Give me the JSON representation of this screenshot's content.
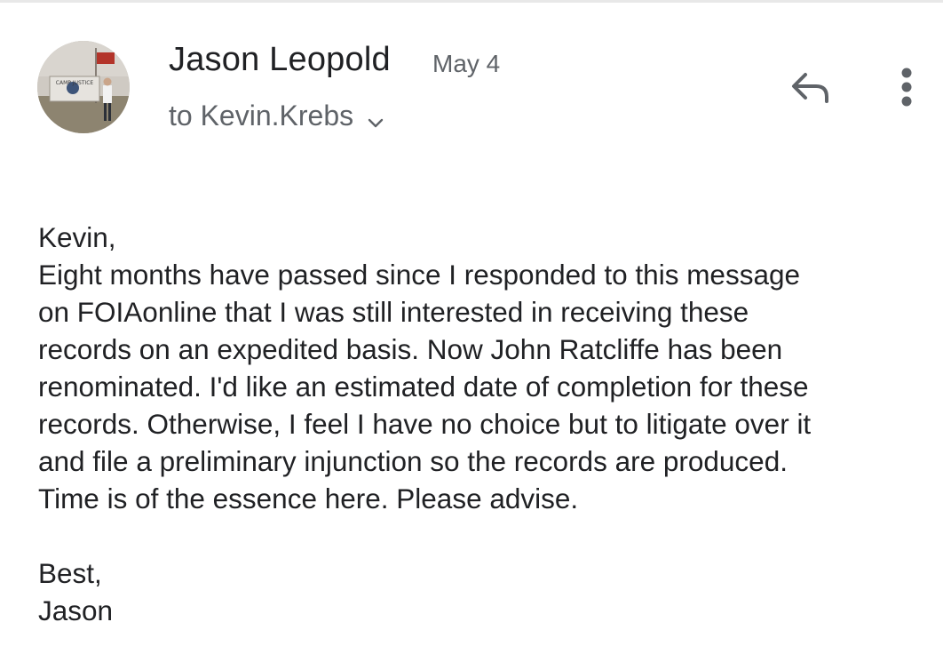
{
  "message": {
    "sender_name": "Jason Leopold",
    "date": "May 4",
    "recipient_label": "to Kevin.Krebs",
    "body_lines": [
      "Kevin,",
      "Eight months have passed since I responded to this message",
      "on FOIAonline that I was still interested in receiving these",
      "records on an expedited basis. Now John Ratcliffe has been",
      "renominated. I'd like an estimated date of completion for these",
      "records. Otherwise, I feel I have no choice but to litigate over it",
      "and file a preliminary injunction so the records are produced.",
      "Time is of the essence here. Please advise."
    ],
    "signoff_lines": [
      "Best,",
      "Jason"
    ]
  },
  "avatar_sign_text": "CAMP JUSTICE",
  "icons": {
    "reply": "reply-icon",
    "more": "more-vert-icon",
    "expand": "chevron-down-icon"
  },
  "colors": {
    "text_primary": "#202124",
    "text_secondary": "#5f6368",
    "background": "#ffffff"
  }
}
